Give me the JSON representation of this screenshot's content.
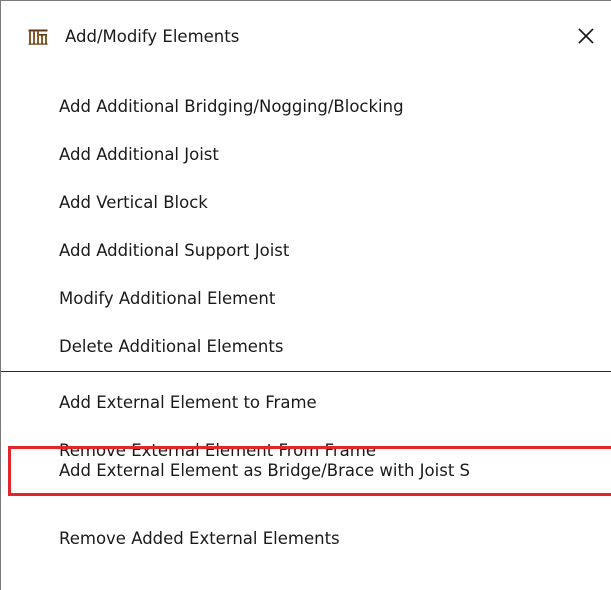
{
  "window": {
    "title": "Add/Modify Elements",
    "icon": "frame-elements-icon",
    "close_icon": "close-icon"
  },
  "menu": {
    "group1": [
      {
        "label": "Add Additional Bridging/Nogging/Blocking"
      },
      {
        "label": "Add Additional Joist"
      },
      {
        "label": "Add Vertical Block"
      },
      {
        "label": "Add Additional Support Joist"
      },
      {
        "label": "Modify Additional Element"
      },
      {
        "label": "Delete Additional Elements"
      }
    ],
    "group2": [
      {
        "label": "Add External Element to Frame"
      },
      {
        "label": "Remove External Element From Frame"
      },
      {
        "label": "Add External Element as Bridge/Brace with Joist S",
        "highlighted": true
      },
      {
        "label": "Remove Added External Elements"
      }
    ]
  },
  "colors": {
    "highlight_border": "#e3262a",
    "text": "#1a1a1a",
    "separator": "#2a2a2a"
  }
}
